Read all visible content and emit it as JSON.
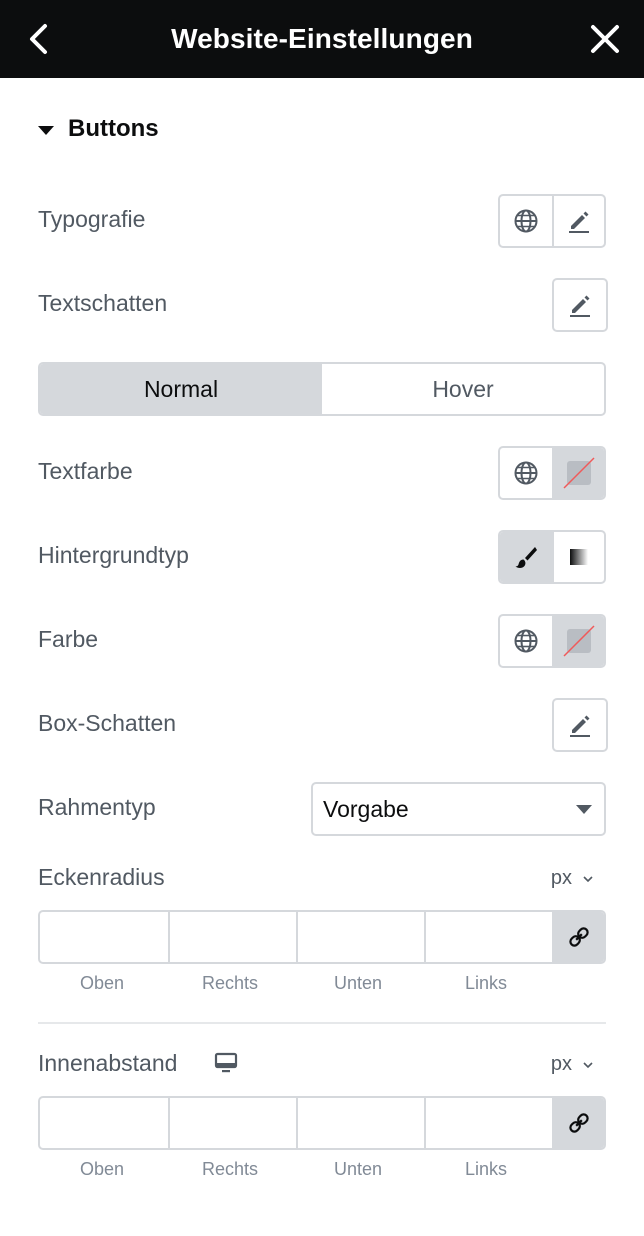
{
  "header": {
    "title": "Website-Einstellungen"
  },
  "section": {
    "title": "Buttons"
  },
  "rows": {
    "typografie": "Typografie",
    "textschatten": "Textschatten",
    "textfarbe": "Textfarbe",
    "hintergrundtyp": "Hintergrundtyp",
    "farbe": "Farbe",
    "box_schatten": "Box-Schatten",
    "rahmentyp": "Rahmentyp",
    "eckenradius": "Eckenradius",
    "innenabstand": "Innenabstand"
  },
  "tabs": {
    "normal": "Normal",
    "hover": "Hover",
    "active": "Normal"
  },
  "rahmentyp_select": {
    "value": "Vorgabe"
  },
  "units": {
    "eckenradius": "px",
    "innenabstand": "px"
  },
  "dimension_labels": {
    "top": "Oben",
    "right": "Rechts",
    "bottom": "Unten",
    "left": "Links"
  },
  "icons": [
    "back-icon",
    "close-icon",
    "globe-icon",
    "pencil-icon",
    "empty-color-swatch-icon",
    "brush-icon",
    "gradient-icon",
    "link-icon",
    "desktop-monitor-icon"
  ],
  "colors": {
    "header_bg": "#0c0d0e",
    "border": "#d5d8dc",
    "text": "#515962"
  }
}
